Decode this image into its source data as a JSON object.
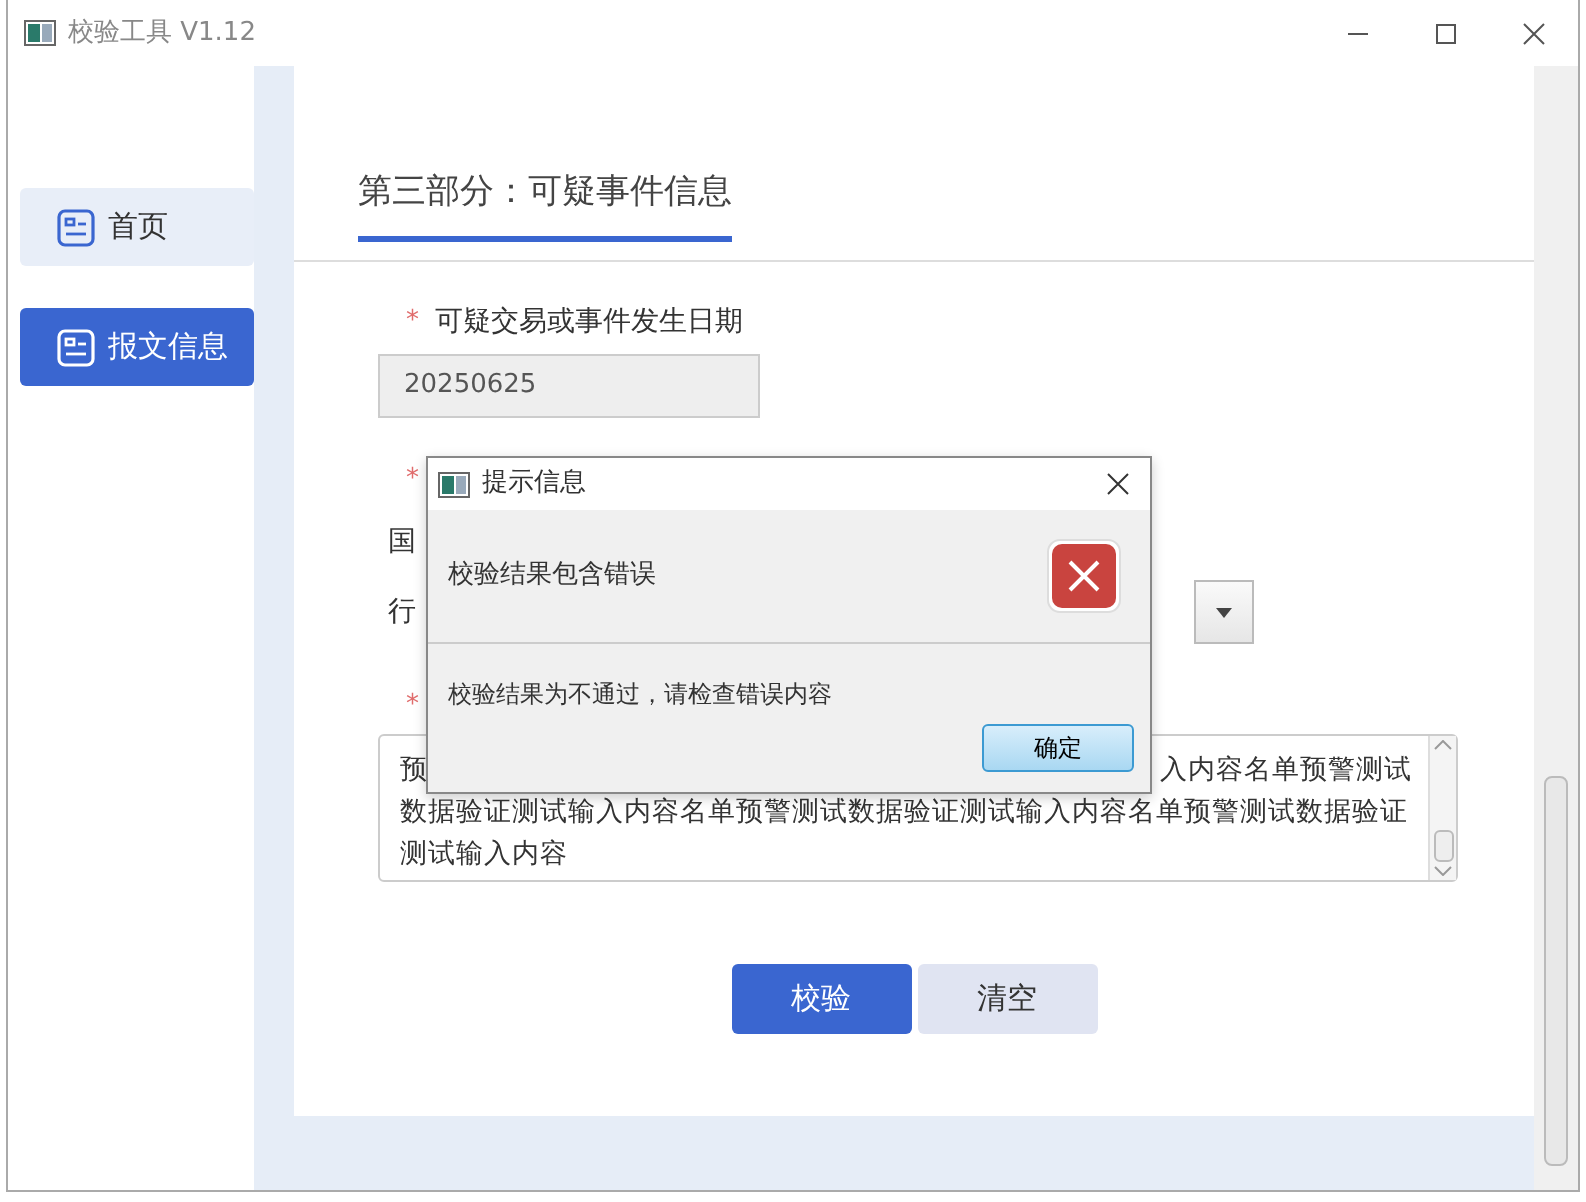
{
  "window": {
    "title": "校验工具 V1.12"
  },
  "sidebar": {
    "items": [
      {
        "label": "首页",
        "selected": false
      },
      {
        "label": "报文信息",
        "selected": true
      }
    ]
  },
  "section": {
    "title": "第三部分：可疑事件信息"
  },
  "form": {
    "fields": [
      {
        "kind": "input",
        "mark": "*",
        "label": "可疑交易或事件发生日期",
        "value": "20250625"
      },
      {
        "kind": "marker",
        "mark": "*"
      },
      {
        "kind": "caption",
        "label": "国"
      },
      {
        "kind": "select",
        "label": "行"
      },
      {
        "kind": "marker",
        "mark": "*"
      },
      {
        "kind": "textarea",
        "lines": [
          [
            "预",
            "入内容名单预警测试"
          ],
          [
            "数据验证测试输入内容名单预警测试数据验证测试输入内容名单预警测试数据验证"
          ],
          [
            "测试输入内容"
          ]
        ]
      }
    ]
  },
  "buttons": [
    {
      "label": "校验",
      "primary": true
    },
    {
      "label": "清空",
      "primary": false
    }
  ],
  "dialog": {
    "title": "提示信息",
    "heading": "校验结果包含错误",
    "message": "校验结果为不通过，请检查错误内容",
    "button": "确定"
  }
}
